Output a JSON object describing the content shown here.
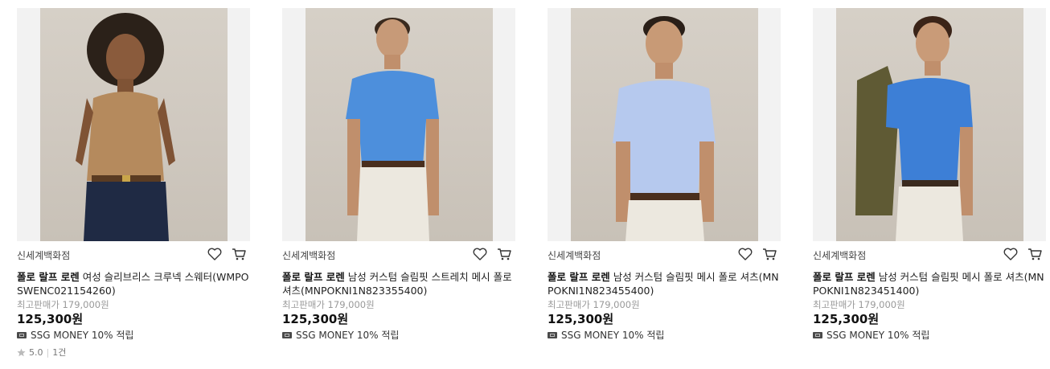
{
  "products": [
    {
      "seller": "신세계백화점",
      "brand": "폴로 랄프 로렌",
      "title": "여성 슬리브리스 크루넥 스웨터(WMPOSWENC021154260)",
      "original_price": "최고판매가 179,000원",
      "price": "125,300원",
      "promo": "SSG MONEY 10% 적립",
      "rating": "5.0",
      "review_count": "1건"
    },
    {
      "seller": "신세계백화점",
      "brand": "폴로 랄프 로렌",
      "title": "남성 커스텀 슬림핏 스트레치 메시 폴로셔츠(MNPOKNI1N823355400)",
      "original_price": "최고판매가 179,000원",
      "price": "125,300원",
      "promo": "SSG MONEY 10% 적립"
    },
    {
      "seller": "신세계백화점",
      "brand": "폴로 랄프 로렌",
      "title": "남성 커스텀 슬림핏 메시 폴로 셔츠(MNPOKNI1N823455400)",
      "original_price": "최고판매가 179,000원",
      "price": "125,300원",
      "promo": "SSG MONEY 10% 적립"
    },
    {
      "seller": "신세계백화점",
      "brand": "폴로 랄프 로렌",
      "title": "남성 커스텀 슬림핏 메시 폴로 셔츠(MNPOKNI1N823451400)",
      "original_price": "최고판매가 179,000원",
      "price": "125,300원",
      "promo": "SSG MONEY 10% 적립"
    }
  ],
  "icons": {
    "wishlist": "heart-icon",
    "cart": "cart-icon",
    "promo": "ssg-money-icon",
    "rating": "star-icon"
  }
}
